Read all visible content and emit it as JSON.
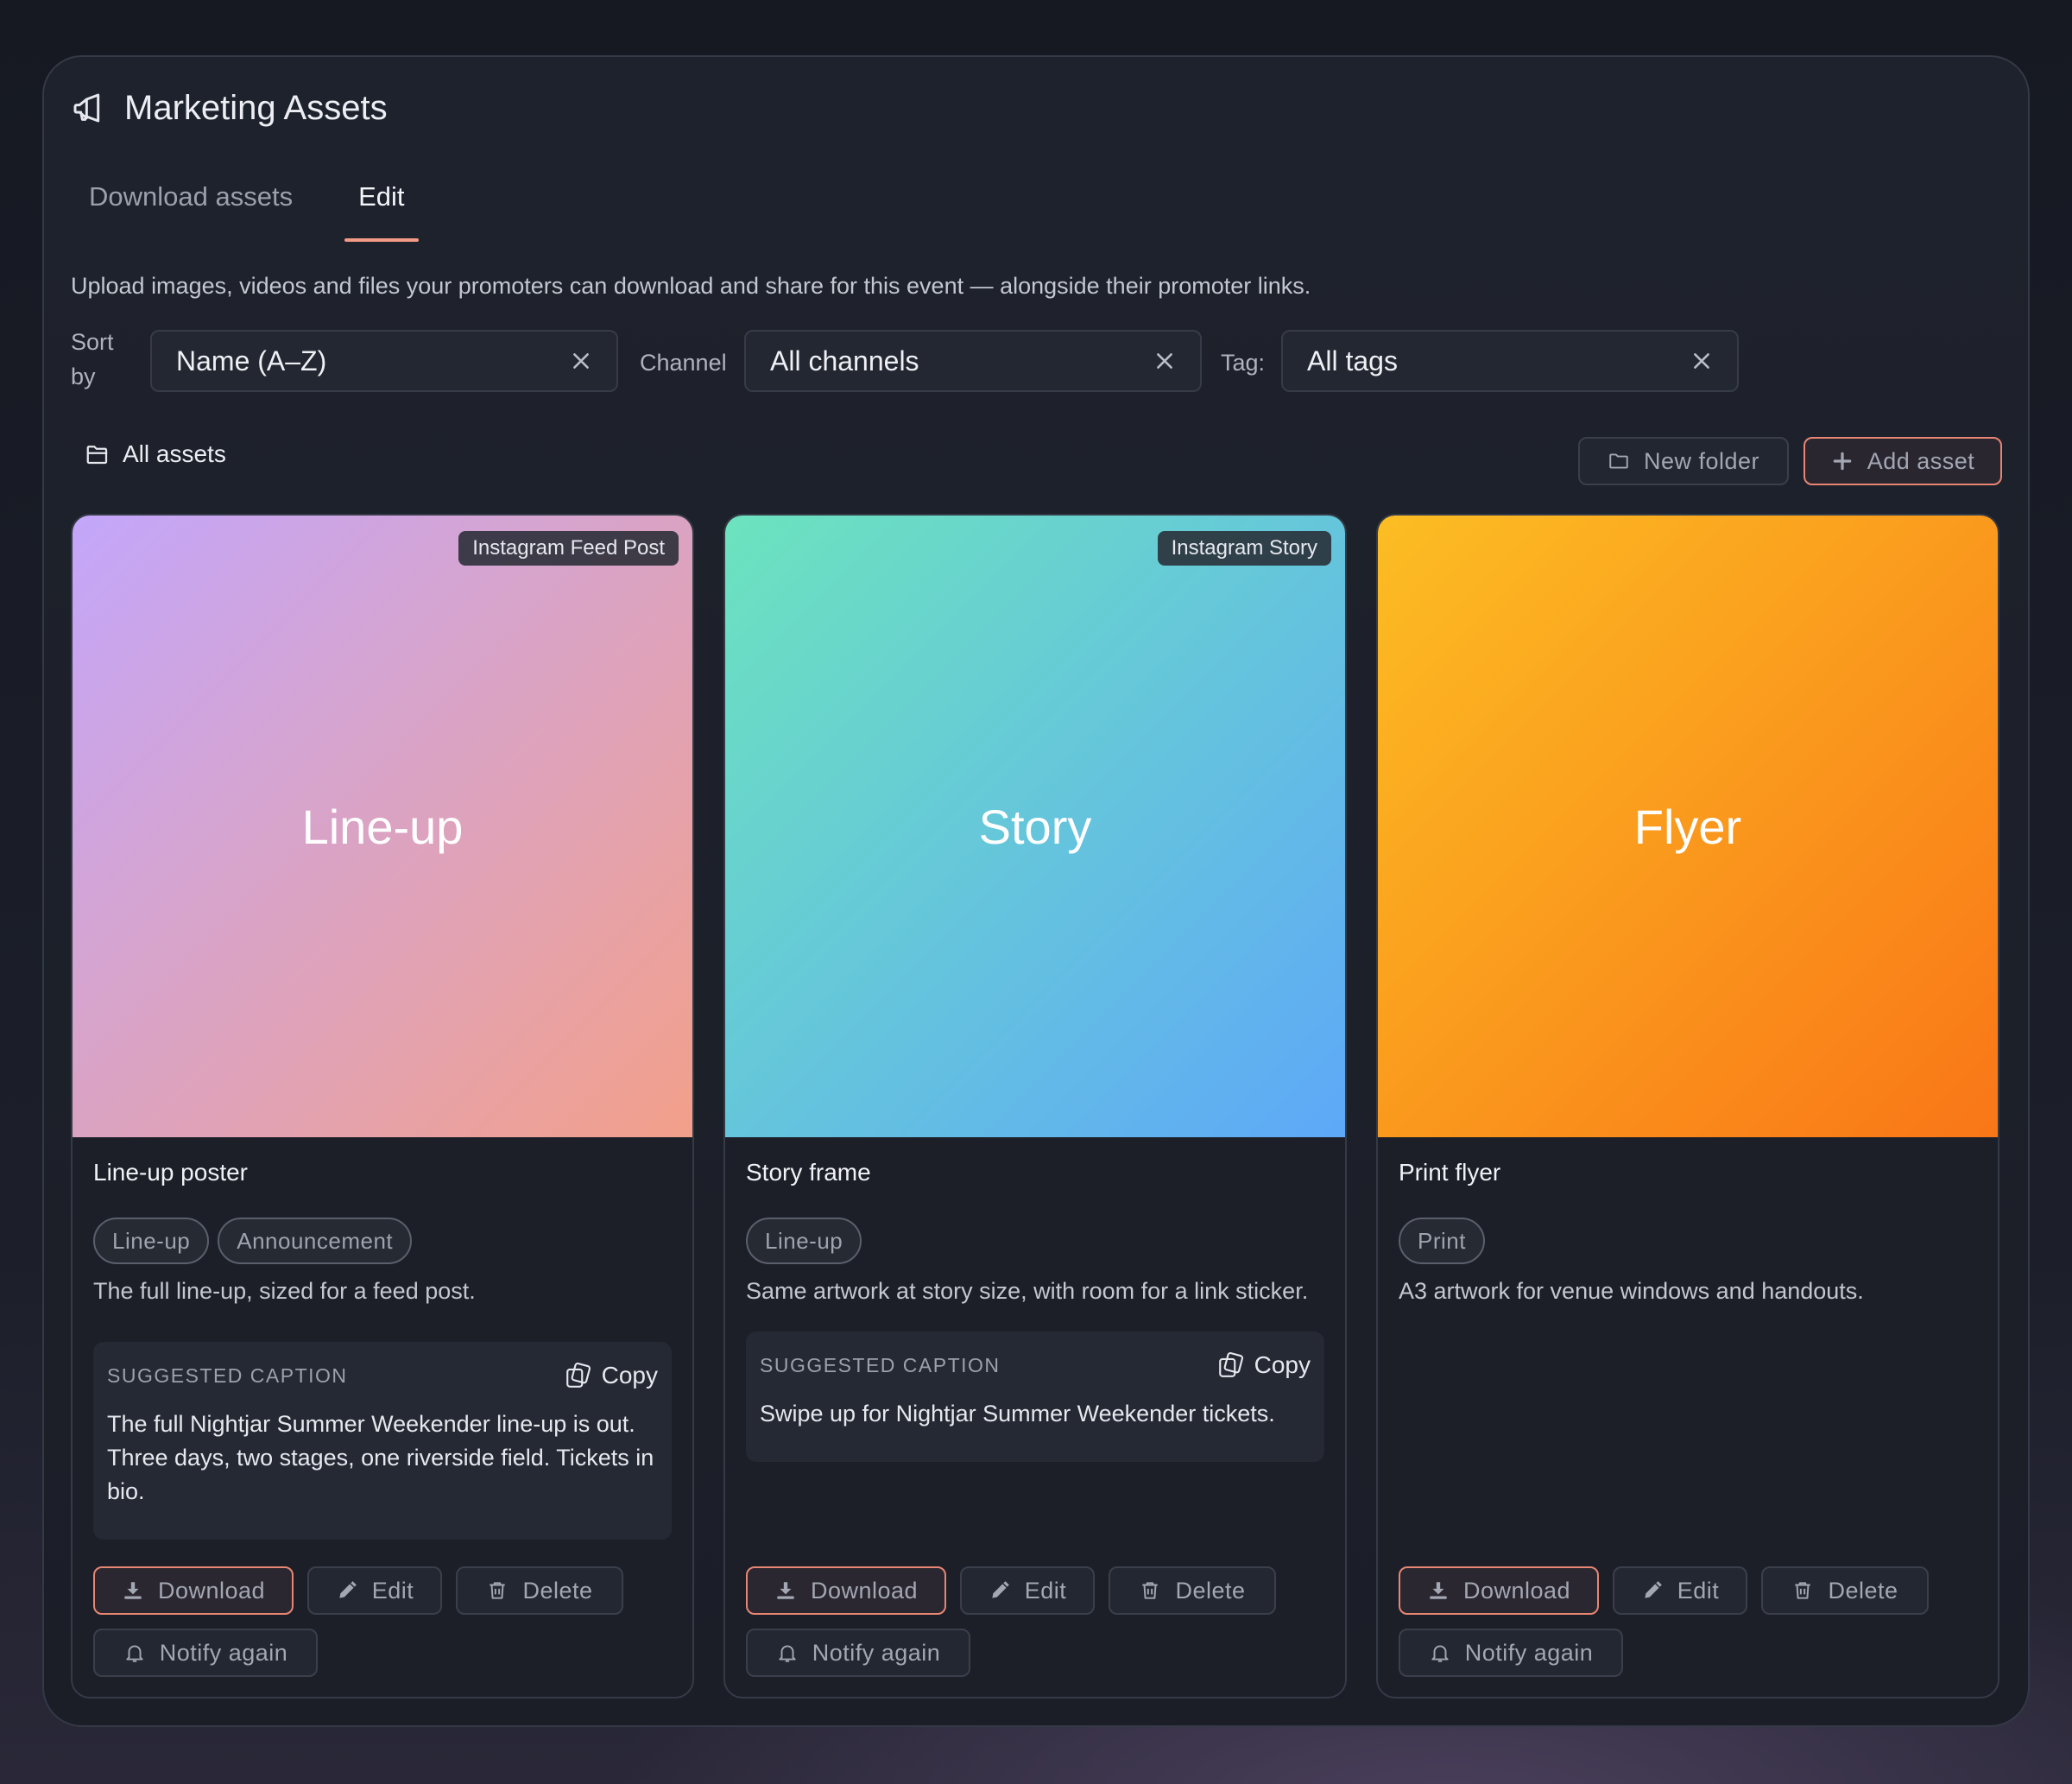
{
  "header": {
    "title": "Marketing Assets"
  },
  "tabs": [
    {
      "label": "Download assets",
      "active": false
    },
    {
      "label": "Edit",
      "active": true
    }
  ],
  "description": "Upload images, videos and files your promoters can download and share for this event — alongside their promoter links.",
  "filters": {
    "sort_label": "Sort by",
    "sort_label_line1": "Sort",
    "sort_label_line2": "by",
    "sort_value": "Name (A–Z)",
    "channel_label": "Channel",
    "channel_value": "All channels",
    "tag_label": "Tag:",
    "tag_value": "All tags"
  },
  "toolbar": {
    "folder_label": "All assets",
    "new_folder_label": "New folder",
    "add_asset_label": "Add asset"
  },
  "cards": [
    {
      "hero_text": "Line-up",
      "badge": "Instagram Feed Post",
      "title": "Line-up poster",
      "tags": [
        "Line-up",
        "Announcement"
      ],
      "description": "The full line-up, sized for a feed post.",
      "caption_label": "SUGGESTED CAPTION",
      "caption": "The full Nightjar Summer Weekender line-up is out. Three days, two stages, one riverside field. Tickets in bio.",
      "copy_label": "Copy",
      "gradient": [
        "#c3a6fb",
        "#f3a08a"
      ]
    },
    {
      "hero_text": "Story",
      "badge": "Instagram Story",
      "title": "Story frame",
      "tags": [
        "Line-up"
      ],
      "description": "Same artwork at story size, with room for a link sticker.",
      "caption_label": "SUGGESTED CAPTION",
      "caption": "Swipe up for Nightjar Summer Weekender tickets.",
      "copy_label": "Copy",
      "gradient": [
        "#6ce3be",
        "#5ea8f8"
      ]
    },
    {
      "hero_text": "Flyer",
      "badge": "",
      "title": "Print flyer",
      "tags": [
        "Print"
      ],
      "description": "A3 artwork for venue windows and handouts.",
      "caption_label": "",
      "caption": "",
      "copy_label": "",
      "gradient": [
        "#fcbd23",
        "#f97617"
      ]
    }
  ],
  "card_actions": {
    "download": "Download",
    "edit": "Edit",
    "delete": "Delete",
    "notify": "Notify again"
  },
  "colors": {
    "accent": "#f29a86",
    "background": "#1c1f28"
  }
}
